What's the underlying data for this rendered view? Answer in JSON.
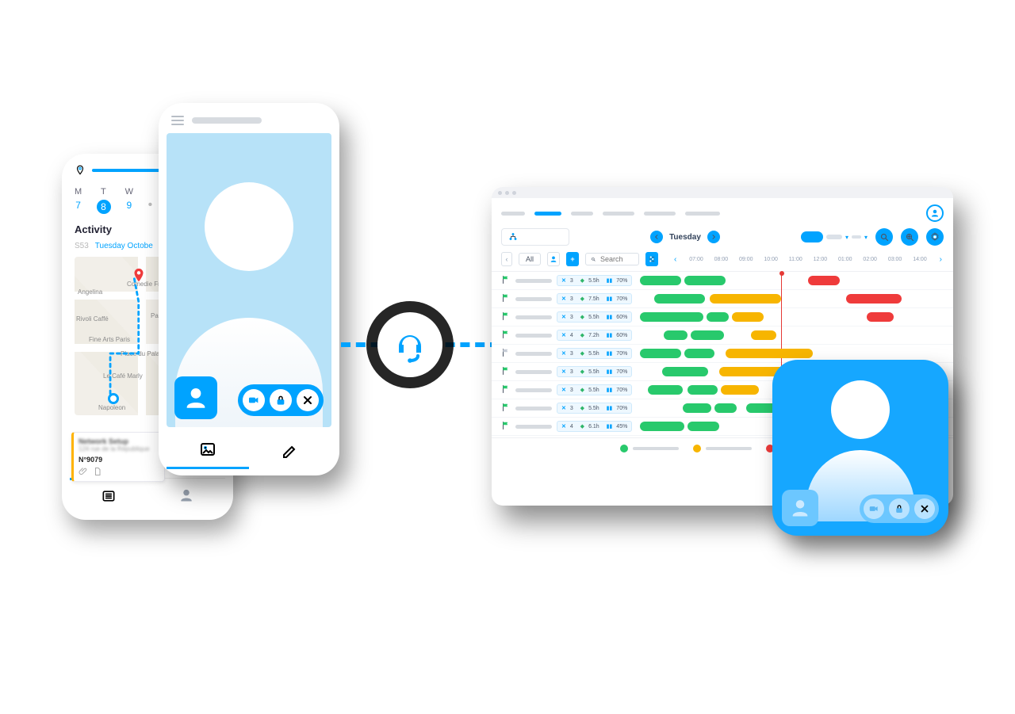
{
  "phone_back": {
    "days": [
      {
        "letter": "M",
        "num": "7"
      },
      {
        "letter": "T",
        "num": "8",
        "selected": true
      },
      {
        "letter": "W",
        "num": "9"
      }
    ],
    "activity_label": "Activity",
    "week_tag": "S53",
    "date_line": "Tuesday Octobe",
    "map_pois": [
      "Comedie Française",
      "Palais-Royal",
      "Fine Arts Paris",
      "Place du Palais-Royal",
      "Le Café Marly",
      "Angelina",
      "Rivoli Caffé",
      "Napoleon"
    ],
    "card": {
      "title": "Network Setup",
      "addr": "124 rue de la République",
      "number": "N°9079"
    }
  },
  "desktop": {
    "day_label": "Tuesday",
    "all_label": "All",
    "search_placeholder": "Search",
    "hours": [
      "07:00",
      "08:00",
      "09:00",
      "10:00",
      "11:00",
      "12:00",
      "01:00",
      "02:00",
      "03:00",
      "14:00"
    ],
    "rows": [
      {
        "flag": "green",
        "badge": {
          "x": "3",
          "t": "5.5h",
          "l": "70%"
        },
        "bars": [
          {
            "c": "g",
            "s": 0,
            "w": 52
          },
          {
            "c": "g",
            "s": 56,
            "w": 52
          },
          {
            "c": "r",
            "s": 212,
            "w": 40
          }
        ]
      },
      {
        "flag": "green",
        "badge": {
          "x": "3",
          "t": "7.5h",
          "l": "70%"
        },
        "bars": [
          {
            "c": "g",
            "s": 18,
            "w": 64
          },
          {
            "c": "y",
            "s": 88,
            "w": 90
          },
          {
            "c": "r",
            "s": 260,
            "w": 70
          }
        ]
      },
      {
        "flag": "green",
        "badge": {
          "x": "3",
          "t": "5.5h",
          "l": "60%"
        },
        "bars": [
          {
            "c": "g",
            "s": 0,
            "w": 80
          },
          {
            "c": "g",
            "s": 84,
            "w": 28
          },
          {
            "c": "y",
            "s": 116,
            "w": 40
          },
          {
            "c": "r",
            "s": 286,
            "w": 34
          }
        ]
      },
      {
        "flag": "green",
        "badge": {
          "x": "4",
          "t": "7.2h",
          "l": "60%"
        },
        "bars": [
          {
            "c": "g",
            "s": 30,
            "w": 30
          },
          {
            "c": "g",
            "s": 64,
            "w": 42
          },
          {
            "c": "y",
            "s": 140,
            "w": 32
          }
        ]
      },
      {
        "flag": "gray",
        "badge": {
          "x": "3",
          "t": "5.5h",
          "l": "70%"
        },
        "bars": [
          {
            "c": "g",
            "s": 0,
            "w": 52
          },
          {
            "c": "g",
            "s": 56,
            "w": 38
          },
          {
            "c": "y",
            "s": 108,
            "w": 110
          }
        ]
      },
      {
        "flag": "green",
        "badge": {
          "x": "3",
          "t": "5.5h",
          "l": "70%"
        },
        "bars": [
          {
            "c": "g",
            "s": 28,
            "w": 58
          },
          {
            "c": "y",
            "s": 100,
            "w": 120
          }
        ]
      },
      {
        "flag": "green",
        "badge": {
          "x": "3",
          "t": "5.5h",
          "l": "70%"
        },
        "bars": [
          {
            "c": "g",
            "s": 10,
            "w": 44
          },
          {
            "c": "g",
            "s": 60,
            "w": 38
          },
          {
            "c": "y",
            "s": 102,
            "w": 48
          }
        ]
      },
      {
        "flag": "green",
        "badge": {
          "x": "3",
          "t": "5.5h",
          "l": "70%"
        },
        "bars": [
          {
            "c": "g",
            "s": 54,
            "w": 36
          },
          {
            "c": "g",
            "s": 94,
            "w": 28
          },
          {
            "c": "g",
            "s": 134,
            "w": 62
          }
        ]
      },
      {
        "flag": "green",
        "badge": {
          "x": "4",
          "t": "6.1h",
          "l": "45%"
        },
        "bars": [
          {
            "c": "g",
            "s": 0,
            "w": 56
          },
          {
            "c": "g",
            "s": 60,
            "w": 40
          }
        ]
      }
    ]
  }
}
